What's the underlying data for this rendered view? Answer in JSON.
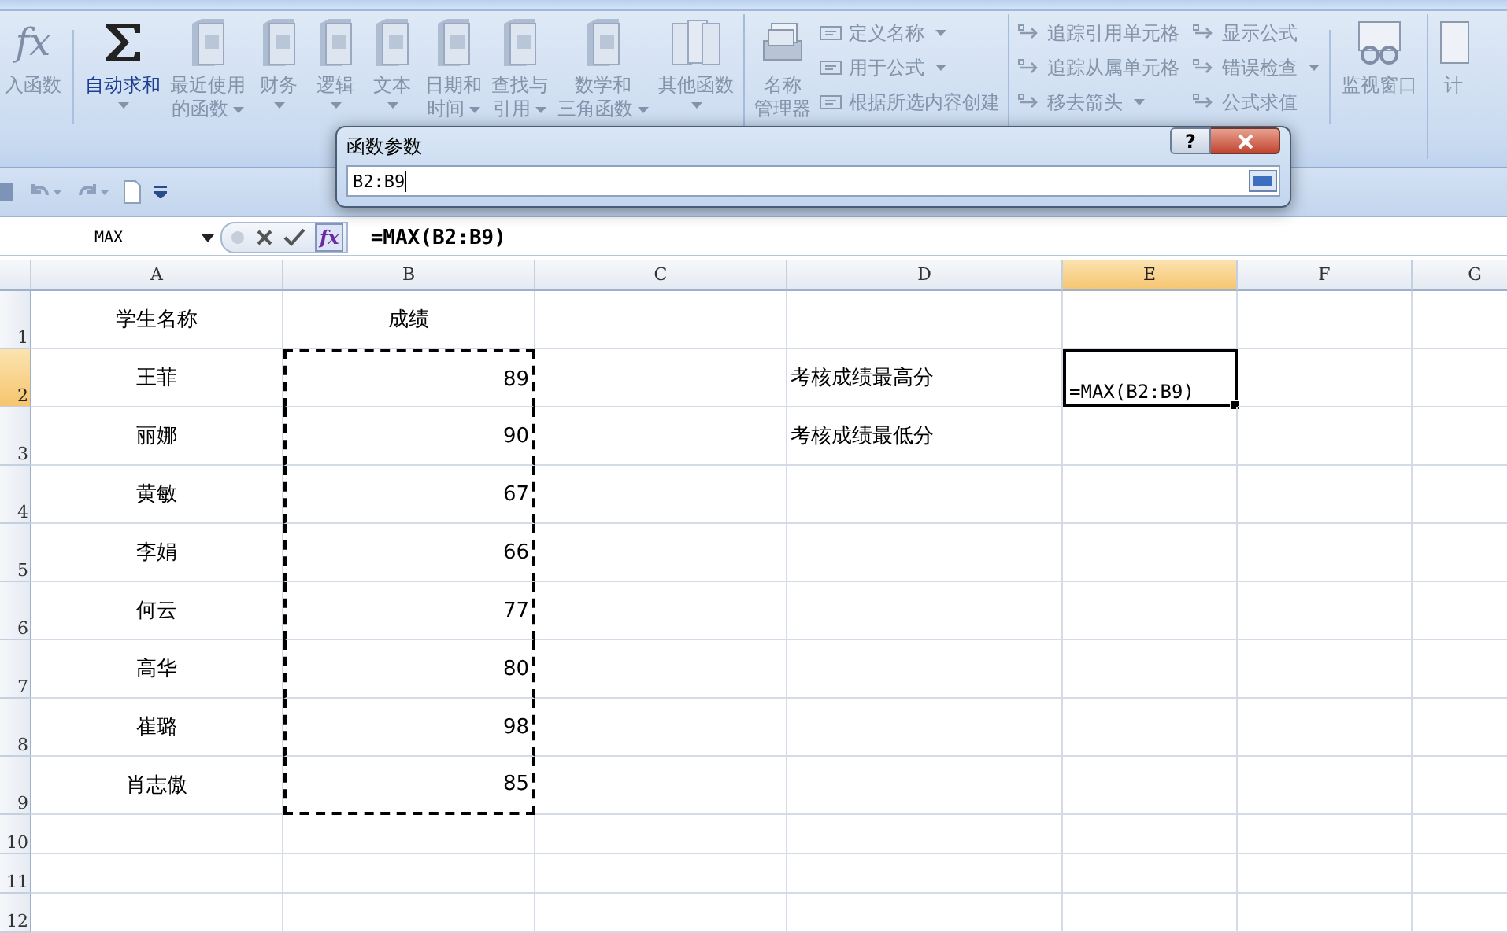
{
  "ribbon": {
    "large_buttons": [
      {
        "kind": "fx",
        "symbol": "fx",
        "label": "入函数",
        "dropdown": false,
        "highlighted": false
      },
      {
        "kind": "sigma",
        "label": "自动求和",
        "dropdown": true,
        "highlighted": true
      },
      {
        "kind": "book",
        "label": "最近使用",
        "label2": "的函数",
        "dropdown": true,
        "highlighted": false
      },
      {
        "kind": "book",
        "label": "财务",
        "dropdown": true,
        "highlighted": false
      },
      {
        "kind": "book",
        "label": "逻辑",
        "dropdown": true,
        "highlighted": false
      },
      {
        "kind": "book",
        "label": "文本",
        "dropdown": true,
        "highlighted": false
      },
      {
        "kind": "book",
        "label": "日期和",
        "label2": "时间",
        "dropdown": true,
        "highlighted": false
      },
      {
        "kind": "book",
        "label": "查找与",
        "label2": "引用",
        "dropdown": true,
        "highlighted": false
      },
      {
        "kind": "book",
        "label": "数学和",
        "label2": "三角函数",
        "dropdown": true,
        "highlighted": false
      },
      {
        "kind": "books",
        "label": "其他函数",
        "dropdown": true,
        "highlighted": false
      }
    ],
    "names_group": {
      "manager": {
        "label": "名称",
        "label2": "管理器"
      },
      "items": [
        {
          "label": "定义名称",
          "dropdown": true
        },
        {
          "label": "用于公式",
          "dropdown": true
        },
        {
          "label": "根据所选内容创建",
          "dropdown": false
        }
      ]
    },
    "auditing_group": {
      "items": [
        {
          "label": "追踪引用单元格",
          "dropdown": false
        },
        {
          "label": "显示公式",
          "dropdown": false
        },
        {
          "label": "追踪从属单元格",
          "dropdown": false
        },
        {
          "label": "错误检查",
          "dropdown": true
        },
        {
          "label": "移去箭头",
          "dropdown": true
        },
        {
          "label": "公式求值",
          "dropdown": false
        }
      ],
      "watch": {
        "label": "监视窗口"
      }
    },
    "calc": {
      "label": "计"
    }
  },
  "dialog": {
    "title": "函数参数",
    "help": "?",
    "value": "B2:B9"
  },
  "formula_bar": {
    "name_box": "MAX",
    "fx": "fx",
    "formula": "=MAX(B2:B9)"
  },
  "sheet": {
    "columns": [
      {
        "label": "A",
        "selected": false
      },
      {
        "label": "B",
        "selected": false
      },
      {
        "label": "C",
        "selected": false
      },
      {
        "label": "D",
        "selected": false
      },
      {
        "label": "E",
        "selected": true
      },
      {
        "label": "F",
        "selected": false
      },
      {
        "label": "G",
        "selected": false
      }
    ],
    "rows": [
      {
        "header": "1",
        "selected": false,
        "cells": [
          {
            "text": "学生名称",
            "kind": "label"
          },
          {
            "text": "成绩",
            "kind": "label"
          },
          null,
          null,
          null,
          null,
          null
        ]
      },
      {
        "header": "2",
        "selected": true,
        "cells": [
          {
            "text": "王菲",
            "kind": "label"
          },
          {
            "text": "89",
            "kind": "number",
            "in_range": true
          },
          null,
          {
            "text": "考核成绩最高分",
            "kind": "text"
          },
          {
            "text": "=MAX(B2:B9)",
            "kind": "formula",
            "active": true
          },
          null,
          null
        ]
      },
      {
        "header": "3",
        "selected": false,
        "cells": [
          {
            "text": "丽娜",
            "kind": "label"
          },
          {
            "text": "90",
            "kind": "number",
            "in_range": true
          },
          null,
          {
            "text": "考核成绩最低分",
            "kind": "text"
          },
          null,
          null,
          null
        ]
      },
      {
        "header": "4",
        "selected": false,
        "cells": [
          {
            "text": "黄敏",
            "kind": "label"
          },
          {
            "text": "67",
            "kind": "number",
            "in_range": true
          },
          null,
          null,
          null,
          null,
          null
        ]
      },
      {
        "header": "5",
        "selected": false,
        "cells": [
          {
            "text": "李娟",
            "kind": "label"
          },
          {
            "text": "66",
            "kind": "number",
            "in_range": true
          },
          null,
          null,
          null,
          null,
          null
        ]
      },
      {
        "header": "6",
        "selected": false,
        "cells": [
          {
            "text": "何云",
            "kind": "label"
          },
          {
            "text": "77",
            "kind": "number",
            "in_range": true
          },
          null,
          null,
          null,
          null,
          null
        ]
      },
      {
        "header": "7",
        "selected": false,
        "cells": [
          {
            "text": "高华",
            "kind": "label"
          },
          {
            "text": "80",
            "kind": "number",
            "in_range": true
          },
          null,
          null,
          null,
          null,
          null
        ]
      },
      {
        "header": "8",
        "selected": false,
        "cells": [
          {
            "text": "崔璐",
            "kind": "label"
          },
          {
            "text": "98",
            "kind": "number",
            "in_range": true
          },
          null,
          null,
          null,
          null,
          null
        ]
      },
      {
        "header": "9",
        "selected": false,
        "cells": [
          {
            "text": "肖志傲",
            "kind": "label"
          },
          {
            "text": "85",
            "kind": "number",
            "in_range": true
          },
          null,
          null,
          null,
          null,
          null
        ]
      },
      {
        "header": "10",
        "selected": false,
        "cells": [
          null,
          null,
          null,
          null,
          null,
          null,
          null
        ]
      },
      {
        "header": "11",
        "selected": false,
        "cells": [
          null,
          null,
          null,
          null,
          null,
          null,
          null
        ]
      },
      {
        "header": "12",
        "selected": false,
        "cells": [
          null,
          null,
          null,
          null,
          null,
          null,
          null
        ]
      }
    ]
  }
}
